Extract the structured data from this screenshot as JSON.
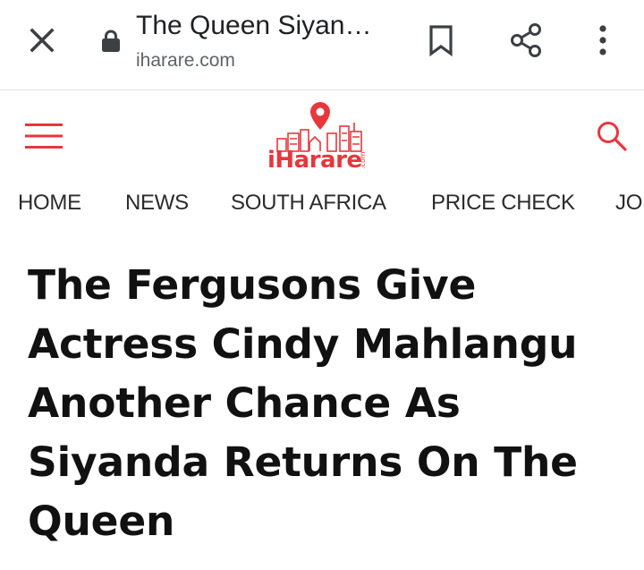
{
  "browser": {
    "page_title": "The Queen Siyan…",
    "url": "iharare.com",
    "icons": [
      "close-icon",
      "lock-icon",
      "bookmark-icon",
      "share-icon",
      "more-vert-icon"
    ]
  },
  "site": {
    "logo_text": "iHarare",
    "logo_suffix": ".com",
    "icons": [
      "menu-icon",
      "search-icon"
    ],
    "accent_color": "#e8363d"
  },
  "nav": {
    "items": [
      "HOME",
      "NEWS",
      "SOUTH AFRICA",
      "PRICE CHECK",
      "JO"
    ]
  },
  "article": {
    "headline": "The Fergusons Give Actress Cindy Mahlangu Another Chance As Siyanda Returns On The Queen"
  }
}
